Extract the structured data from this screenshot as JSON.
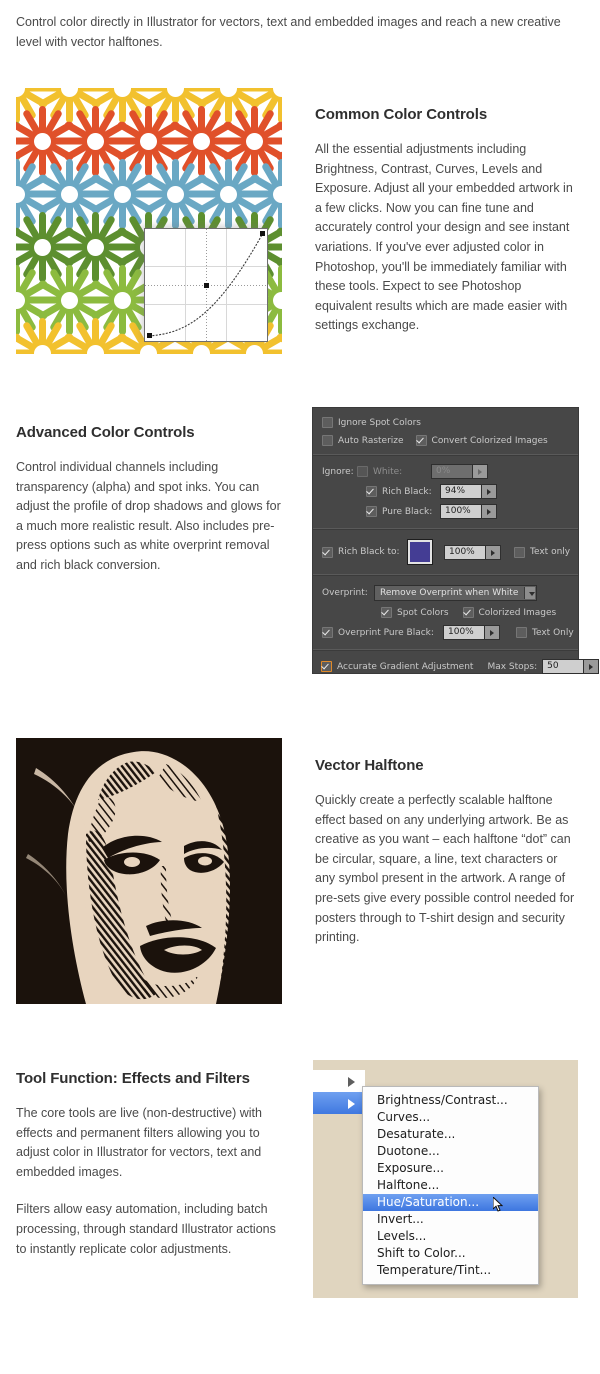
{
  "intro": "Control color directly in Illustrator for vectors, text and embedded images and reach a new creative level with vector halftones.",
  "sections": [
    {
      "heading": "Common Color Controls",
      "body": "All the essential adjustments including Brightness, Contrast, Curves, Levels and Exposure. Adjust all your embedded artwork in a few clicks. Now you can fine tune and accurately control your design and see instant variations. If you've ever adjusted color in Photoshop, you'll be immediately familiar with these tools. Expect to see Photoshop equivalent results which are made easier with settings exchange."
    },
    {
      "heading": "Advanced Color Controls",
      "body": "Control individual channels including transparency (alpha) and spot inks. You can adjust the profile of drop shadows and glows for a much more realistic result. Also includes pre-press options such as white overprint removal and rich black conversion."
    },
    {
      "heading": "Vector Halftone",
      "body": "Quickly create a perfectly scalable halftone effect based on any underlying artwork. Be as creative as you want – each halftone “dot” can be circular, square, a line, text characters or any symbol present in the artwork. A range of pre-sets give every possible control needed for posters through to T-shirt design and security printing."
    },
    {
      "heading": "Tool Function: Effects and Filters",
      "body1": "The core tools are live (non-destructive) with effects and permanent filters allowing you to adjust color in Illustrator for vectors, text and embedded images.",
      "body2": "Filters allow easy automation, including batch processing, through standard Illustrator actions to instantly replicate color adjustments."
    }
  ],
  "dialog": {
    "ignore_spot_colors": "Ignore Spot Colors",
    "auto_rasterize": "Auto Rasterize",
    "convert_colorized_images": "Convert Colorized Images",
    "ignore_label": "Ignore:",
    "white_label": "White:",
    "white_value": "0%",
    "rich_black_label": "Rich Black:",
    "rich_black_value": "94%",
    "pure_black_label": "Pure Black:",
    "pure_black_value": "100%",
    "rich_black_to_label": "Rich Black to:",
    "rich_black_to_value": "100%",
    "rich_black_swatch_color": "#443d94",
    "text_only_1": "Text only",
    "overprint_label": "Overprint:",
    "overprint_value": "Remove Overprint when White",
    "spot_colors": "Spot Colors",
    "colorized_images": "Colorized Images",
    "overprint_pure_black_label": "Overprint Pure Black:",
    "overprint_pure_black_value": "100%",
    "text_only_2": "Text Only",
    "accurate_gradient": "Accurate Gradient Adjustment",
    "max_stops_label": "Max Stops:",
    "max_stops_value": "50",
    "accent_checkbox_color": "#e08a2a"
  },
  "menu": {
    "highlight_color": "#3d76e0",
    "panel_background": "#e0d5bf",
    "items": [
      "Brightness/Contrast...",
      "Curves...",
      "Desaturate...",
      "Duotone...",
      "Exposure...",
      "Halftone...",
      "Hue/Saturation...",
      "Invert...",
      "Levels...",
      "Shift to Color...",
      "Temperature/Tint..."
    ],
    "selected_item": "Hue/Saturation..."
  },
  "artwork": {
    "floral": {
      "name": "floral-pattern-artwork",
      "petal_colors": [
        "#f2c12e",
        "#6aa8c4",
        "#8cbb3f",
        "#e0502a",
        "#5d8f2f"
      ],
      "background": "#ffffff"
    },
    "curve_overlay": {
      "name": "curves-adjustment-overlay",
      "point_count": 3
    },
    "halftone": {
      "name": "halftone-portrait-artwork",
      "ink_color": "#1b120c",
      "paper_color": "#e8d5bf"
    }
  }
}
